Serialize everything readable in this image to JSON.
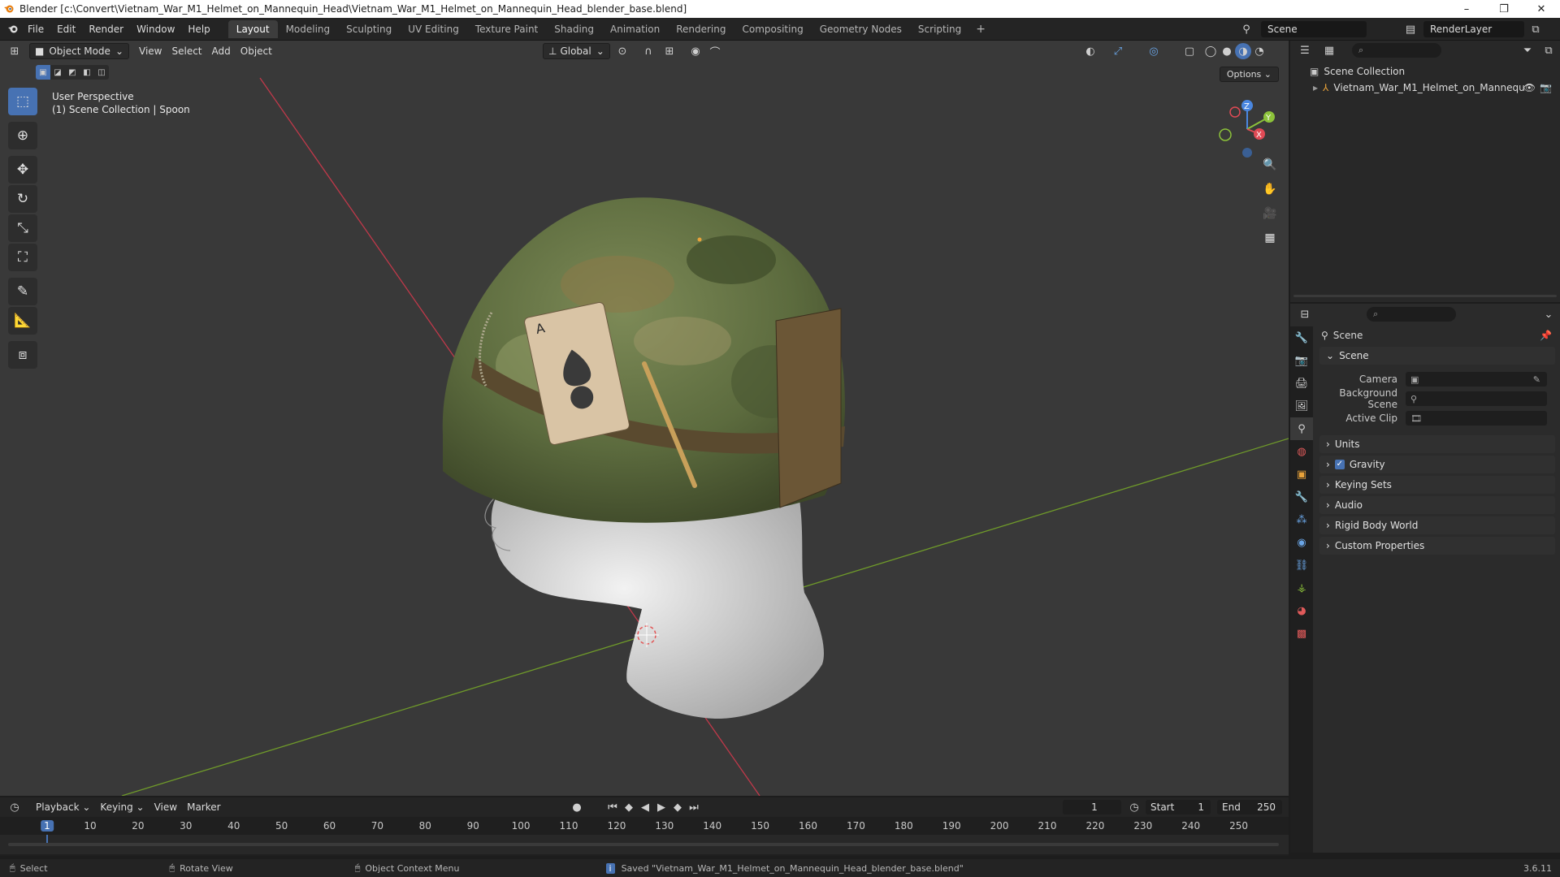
{
  "window": {
    "title": "Blender [c:\\Convert\\Vietnam_War_M1_Helmet_on_Mannequin_Head\\Vietnam_War_M1_Helmet_on_Mannequin_Head_blender_base.blend]",
    "controls": [
      "–",
      "❐",
      "✕"
    ]
  },
  "menus": [
    "File",
    "Edit",
    "Render",
    "Window",
    "Help"
  ],
  "workspaces": [
    "Layout",
    "Modeling",
    "Sculpting",
    "UV Editing",
    "Texture Paint",
    "Shading",
    "Animation",
    "Rendering",
    "Compositing",
    "Geometry Nodes",
    "Scripting"
  ],
  "active_workspace": "Layout",
  "workspace_add": "+",
  "scene": {
    "name": "Scene",
    "layer": "RenderLayer"
  },
  "viewport": {
    "mode": "Object Mode",
    "menus": [
      "View",
      "Select",
      "Add",
      "Object"
    ],
    "transform_orientation": "Global",
    "overlay_line1": "User Perspective",
    "overlay_line2": "(1) Scene Collection | Spoon",
    "options_label": "Options",
    "axes": {
      "x": "X",
      "y": "Y",
      "z": "Z"
    },
    "colors": {
      "bg": "#393939",
      "x_axis": "#c0394a",
      "y_axis": "#6f9a2a",
      "gizmo_x": "#e04a55",
      "gizmo_y": "#8cc23a",
      "gizmo_z": "#4a87e0"
    }
  },
  "toolbar": [
    "select-box",
    "cursor",
    "move",
    "rotate",
    "scale",
    "transform",
    "annotate",
    "measure",
    "add-cube"
  ],
  "outliner": {
    "root": "Scene Collection",
    "items": [
      {
        "name": "Vietnam_War_M1_Helmet_on_Mannequ"
      }
    ],
    "search_placeholder": "⌕"
  },
  "properties": {
    "breadcrumb": "Scene",
    "panel_title": "Scene",
    "fields": [
      {
        "label": "Camera",
        "value": ""
      },
      {
        "label": "Background Scene",
        "value": ""
      },
      {
        "label": "Active Clip",
        "value": ""
      }
    ],
    "subpanels": [
      "Units",
      "Gravity",
      "Keying Sets",
      "Audio",
      "Rigid Body World",
      "Custom Properties"
    ],
    "gravity_checked": true,
    "tab_icons": [
      "tool",
      "render",
      "output",
      "view-layer",
      "scene",
      "world",
      "object",
      "modifiers",
      "particles",
      "physics",
      "constraints",
      "data",
      "material",
      "texture"
    ]
  },
  "timeline": {
    "menus": [
      "Playback",
      "Keying",
      "View",
      "Marker"
    ],
    "current_frame": "1",
    "start_label": "Start",
    "start": "1",
    "end_label": "End",
    "end": "250",
    "ruler": [
      "1",
      "10",
      "20",
      "30",
      "40",
      "50",
      "60",
      "70",
      "80",
      "90",
      "100",
      "110",
      "120",
      "130",
      "140",
      "150",
      "160",
      "170",
      "180",
      "190",
      "200",
      "210",
      "220",
      "230",
      "240",
      "250"
    ]
  },
  "statusbar": {
    "left": "Select",
    "middle": "Rotate View",
    "right": "Object Context Menu",
    "message": "Saved \"Vietnam_War_M1_Helmet_on_Mannequin_Head_blender_base.blend\"",
    "version": "3.6.11"
  }
}
